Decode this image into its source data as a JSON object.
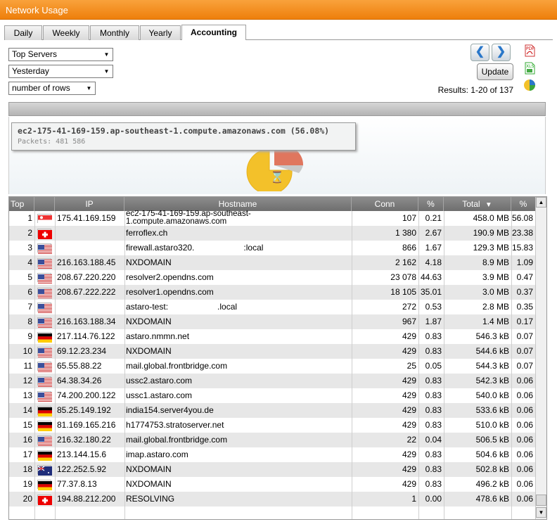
{
  "window": {
    "title": "Network Usage"
  },
  "tabs": [
    {
      "label": "Daily"
    },
    {
      "label": "Weekly"
    },
    {
      "label": "Monthly"
    },
    {
      "label": "Yearly"
    },
    {
      "label": "Accounting",
      "active": true
    }
  ],
  "filters": {
    "report": "Top Servers",
    "period": "Yesterday",
    "rows": "number of rows"
  },
  "controls": {
    "prev": "❮",
    "next": "❯",
    "update": "Update",
    "results": "Results: 1-20 of 137"
  },
  "icons": [
    "pdf-icon",
    "xls-icon",
    "pie-chart-icon"
  ],
  "tooltip": {
    "host": "ec2-175-41-169-159.ap-southeast-1.compute.amazonaws.com (56.08%)",
    "packets": "Packets: 481 586"
  },
  "colors": {
    "accent": "#f59322",
    "pie_main": "#f3c12a",
    "pie_second": "#e0765e"
  },
  "table": {
    "headers": {
      "top": "Top",
      "ip": "IP",
      "hostname": "Hostname",
      "conn": "Conn",
      "pct1": "%",
      "total": "Total",
      "pct2": "%"
    },
    "sort_indicator": "▼",
    "rows": [
      {
        "rank": "1",
        "flag": "sg",
        "ip": "175.41.169.159",
        "host": "ec2-175-41-169-159.ap-southeast-1.compute.amazonaws.com",
        "host1": "ec2-175-41-169-159.ap-southeast-",
        "host2": "1.compute.amazonaws.com",
        "conn": "107",
        "p1": "0.21",
        "total": "458.0 MB",
        "p2": "56.08"
      },
      {
        "rank": "2",
        "flag": "ch",
        "ip": "",
        "host": "ferroflex.ch",
        "conn": "1 380",
        "p1": "2.67",
        "total": "190.9 MB",
        "p2": "23.38"
      },
      {
        "rank": "3",
        "flag": "us",
        "ip": "",
        "host": "firewall.astaro320.",
        "host_tail": ":local",
        "conn": "866",
        "p1": "1.67",
        "total": "129.3 MB",
        "p2": "15.83"
      },
      {
        "rank": "4",
        "flag": "us",
        "ip": "216.163.188.45",
        "host": "NXDOMAIN",
        "conn": "2 162",
        "p1": "4.18",
        "total": "8.9 MB",
        "p2": "1.09"
      },
      {
        "rank": "5",
        "flag": "us",
        "ip": "208.67.220.220",
        "host": "resolver2.opendns.com",
        "conn": "23 078",
        "p1": "44.63",
        "total": "3.9 MB",
        "p2": "0.47"
      },
      {
        "rank": "6",
        "flag": "us",
        "ip": "208.67.222.222",
        "host": "resolver1.opendns.com",
        "conn": "18 105",
        "p1": "35.01",
        "total": "3.0 MB",
        "p2": "0.37"
      },
      {
        "rank": "7",
        "flag": "us",
        "ip": "",
        "host": "astaro-test:",
        "host_tail": ".local",
        "conn": "272",
        "p1": "0.53",
        "total": "2.8 MB",
        "p2": "0.35"
      },
      {
        "rank": "8",
        "flag": "us",
        "ip": "216.163.188.34",
        "host": "NXDOMAIN",
        "conn": "967",
        "p1": "1.87",
        "total": "1.4 MB",
        "p2": "0.17"
      },
      {
        "rank": "9",
        "flag": "de",
        "ip": "217.114.76.122",
        "host": "astaro.nmmn.net",
        "conn": "429",
        "p1": "0.83",
        "total": "546.3 kB",
        "p2": "0.07"
      },
      {
        "rank": "10",
        "flag": "us",
        "ip": "69.12.23.234",
        "host": "NXDOMAIN",
        "conn": "429",
        "p1": "0.83",
        "total": "544.6 kB",
        "p2": "0.07"
      },
      {
        "rank": "11",
        "flag": "us",
        "ip": "65.55.88.22",
        "host": "mail.global.frontbridge.com",
        "conn": "25",
        "p1": "0.05",
        "total": "544.3 kB",
        "p2": "0.07"
      },
      {
        "rank": "12",
        "flag": "us",
        "ip": "64.38.34.26",
        "host": "ussc2.astaro.com",
        "conn": "429",
        "p1": "0.83",
        "total": "542.3 kB",
        "p2": "0.06"
      },
      {
        "rank": "13",
        "flag": "us",
        "ip": "74.200.200.122",
        "host": "ussc1.astaro.com",
        "conn": "429",
        "p1": "0.83",
        "total": "540.0 kB",
        "p2": "0.06"
      },
      {
        "rank": "14",
        "flag": "de",
        "ip": "85.25.149.192",
        "host": "india154.server4you.de",
        "conn": "429",
        "p1": "0.83",
        "total": "533.6 kB",
        "p2": "0.06"
      },
      {
        "rank": "15",
        "flag": "de",
        "ip": "81.169.165.216",
        "host": "h1774753.stratoserver.net",
        "conn": "429",
        "p1": "0.83",
        "total": "510.0 kB",
        "p2": "0.06"
      },
      {
        "rank": "16",
        "flag": "us",
        "ip": "216.32.180.22",
        "host": "mail.global.frontbridge.com",
        "conn": "22",
        "p1": "0.04",
        "total": "506.5 kB",
        "p2": "0.06"
      },
      {
        "rank": "17",
        "flag": "de",
        "ip": "213.144.15.6",
        "host": "imap.astaro.com",
        "conn": "429",
        "p1": "0.83",
        "total": "504.6 kB",
        "p2": "0.06"
      },
      {
        "rank": "18",
        "flag": "au",
        "ip": "122.252.5.92",
        "host": "NXDOMAIN",
        "conn": "429",
        "p1": "0.83",
        "total": "502.8 kB",
        "p2": "0.06"
      },
      {
        "rank": "19",
        "flag": "de",
        "ip": "77.37.8.13",
        "host": "NXDOMAIN",
        "conn": "429",
        "p1": "0.83",
        "total": "496.2 kB",
        "p2": "0.06"
      },
      {
        "rank": "20",
        "flag": "ch",
        "ip": "194.88.212.200",
        "host": "RESOLVING",
        "conn": "1",
        "p1": "0.00",
        "total": "478.6 kB",
        "p2": "0.06"
      }
    ]
  }
}
